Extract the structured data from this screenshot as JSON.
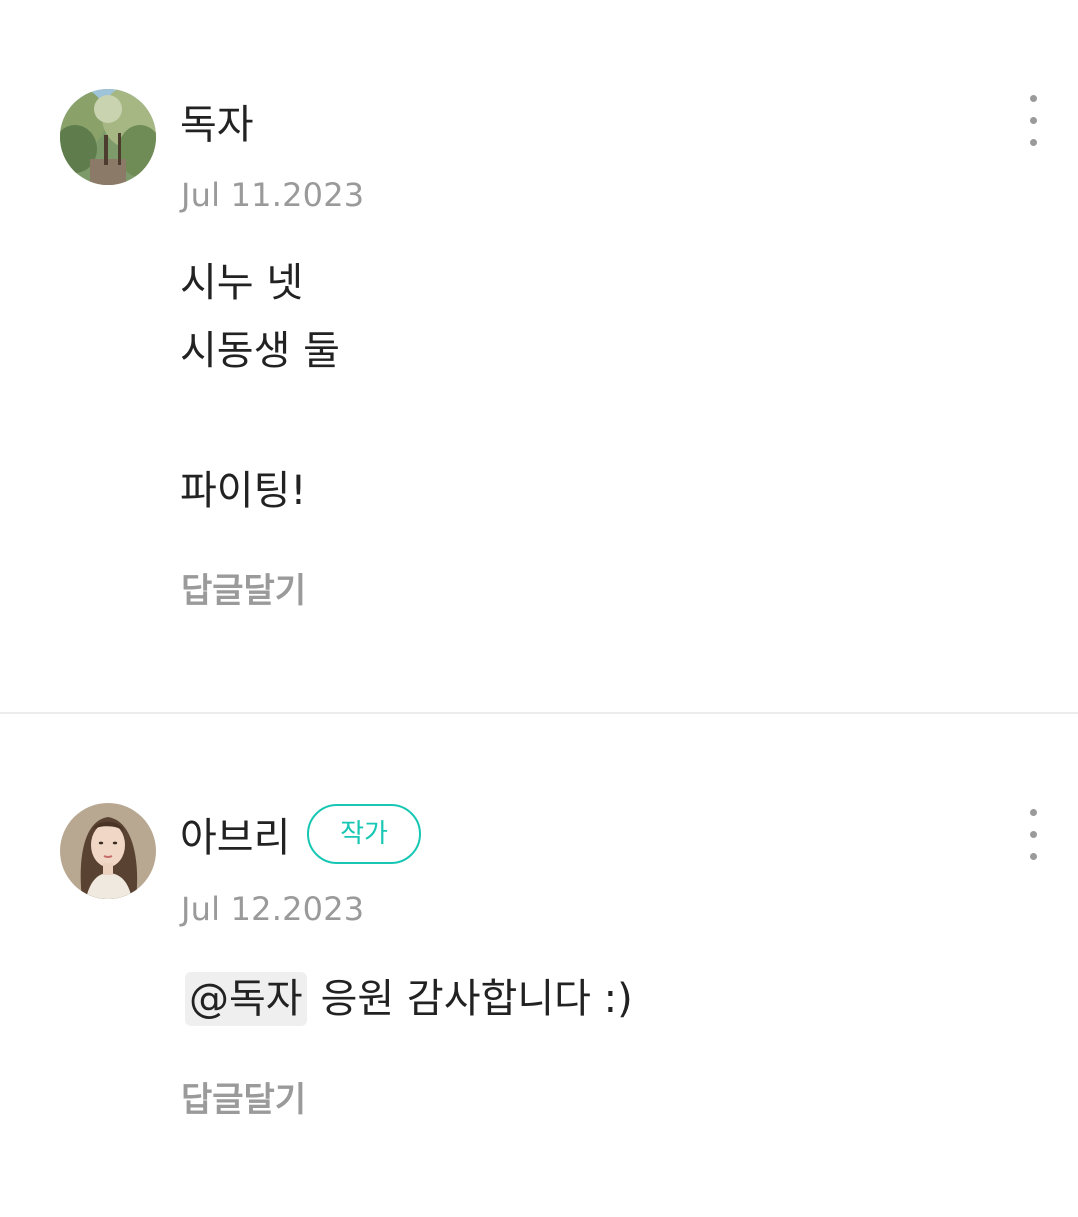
{
  "comments": [
    {
      "author": "독자",
      "is_author_badge": false,
      "date": "Jul 11.2023",
      "body_lines": [
        "시누 넷",
        "시동생 둘",
        "",
        "파이팅!"
      ],
      "reply_label": "답글달기",
      "more_icon": "more-vertical-icon"
    },
    {
      "author": "아브리",
      "badge_label": "작가",
      "date": "Jul 12.2023",
      "mention": "@독자",
      "body_text": "응원 감사합니다 :)",
      "reply_label": "답글달기",
      "more_icon": "more-vertical-icon"
    }
  ],
  "colors": {
    "accent": "#18c7b3",
    "muted": "#9a9a9a",
    "text": "#222222",
    "divider": "#ececec",
    "mention_bg": "#efefef"
  }
}
